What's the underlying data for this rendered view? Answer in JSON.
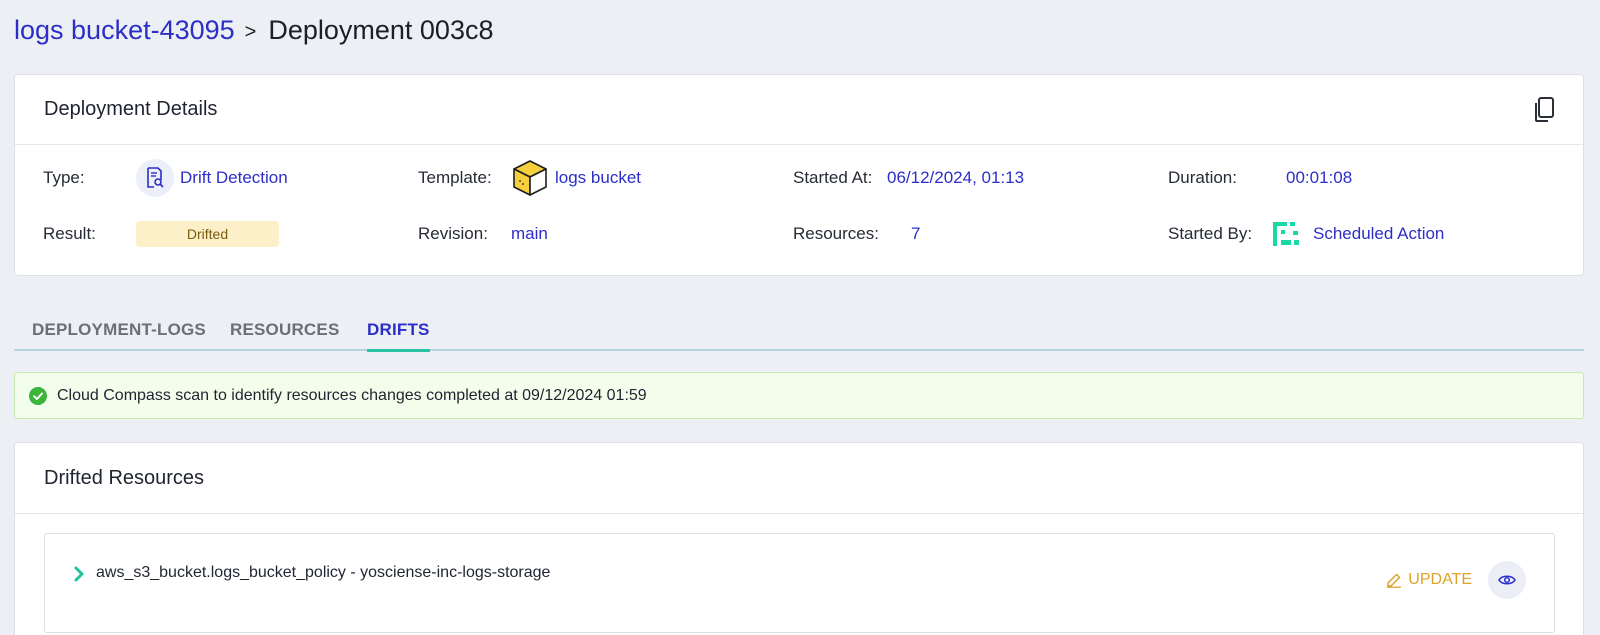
{
  "breadcrumb": {
    "parent": "logs bucket-43095",
    "separator": ">",
    "current": "Deployment 003c8"
  },
  "details": {
    "title": "Deployment Details",
    "type_label": "Type:",
    "type_value": "Drift Detection",
    "template_label": "Template:",
    "template_value": "logs bucket",
    "started_at_label": "Started At:",
    "started_at_value": "06/12/2024, 01:13",
    "duration_label": "Duration:",
    "duration_value": "00:01:08",
    "result_label": "Result:",
    "result_value": "Drifted",
    "revision_label": "Revision:",
    "revision_value": "main",
    "resources_label": "Resources:",
    "resources_value": "7",
    "started_by_label": "Started By:",
    "started_by_value": "Scheduled Action"
  },
  "tabs": [
    {
      "label": "DEPLOYMENT-LOGS",
      "active": false
    },
    {
      "label": "RESOURCES",
      "active": false
    },
    {
      "label": "DRIFTS",
      "active": true
    }
  ],
  "alert": {
    "message": "Cloud Compass scan to identify resources changes completed at 09/12/2024 01:59"
  },
  "drifted": {
    "title": "Drifted Resources",
    "items": [
      {
        "name": "aws_s3_bucket.logs_bucket_policy - yosciense-inc-logs-storage",
        "action_label": "UPDATE"
      }
    ]
  },
  "icons": {
    "type": "drift-detection-icon",
    "template": "package-box-icon",
    "started_by": "scheduled-action-logo-icon",
    "copy": "copy-icon",
    "alert": "check-circle-icon",
    "expand": "chevron-right-icon",
    "update": "pencil-icon",
    "view": "eye-icon"
  },
  "colors": {
    "link": "#2c2fc7",
    "accent_tab": "#27c3a3",
    "update": "#dea42a",
    "drifted_badge": "#fcf0c8",
    "success": "#3cb43a"
  }
}
